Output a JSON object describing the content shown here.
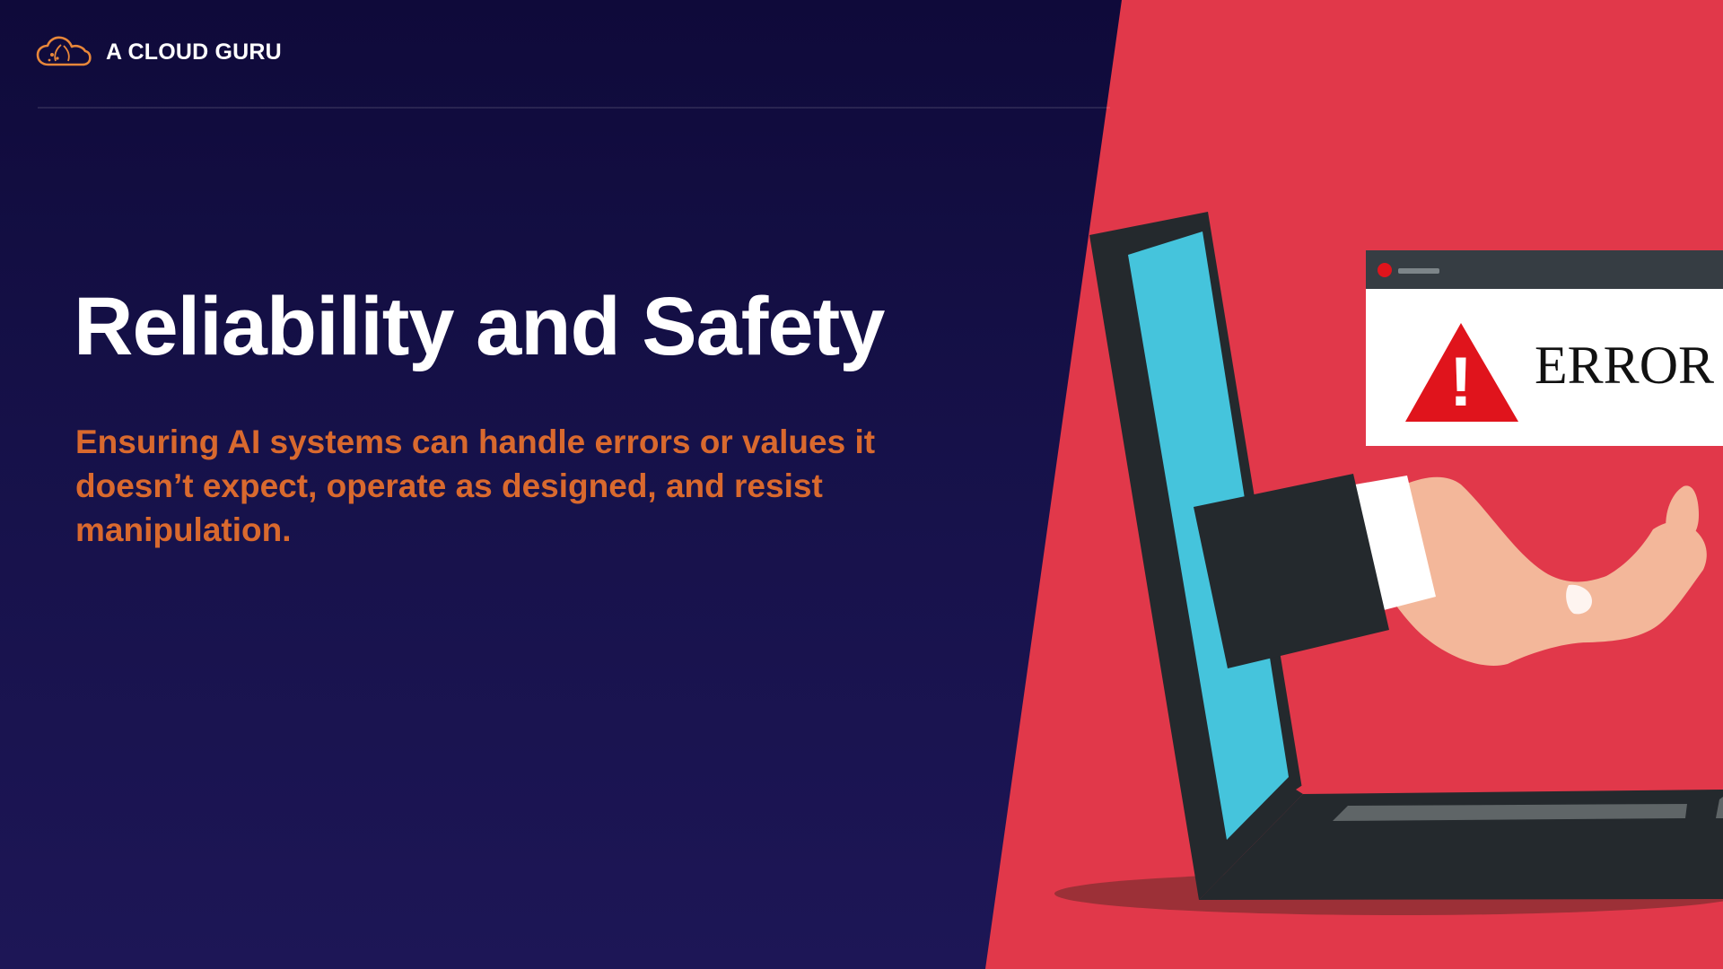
{
  "brand": {
    "name": "A CLOUD GURU",
    "logo_icon": "cloud-logo-icon"
  },
  "slide": {
    "title": "Reliability and Safety",
    "subtitle": "Ensuring AI systems can handle errors or values it doesn’t expect, operate as designed, and resist manipulation."
  },
  "illustration": {
    "error_text": "ERROR",
    "warning_symbol": "!",
    "icons": [
      "laptop-icon",
      "error-window-icon",
      "warning-triangle-icon",
      "hand-icon"
    ]
  },
  "colors": {
    "background_top": "#0f0a3a",
    "background_bottom": "#1d1656",
    "accent_orange": "#d9692e",
    "panel_red": "#e1384a",
    "screen_cyan": "#45c4dc",
    "laptop_dark": "#24292d",
    "warning_red": "#e0141c"
  }
}
